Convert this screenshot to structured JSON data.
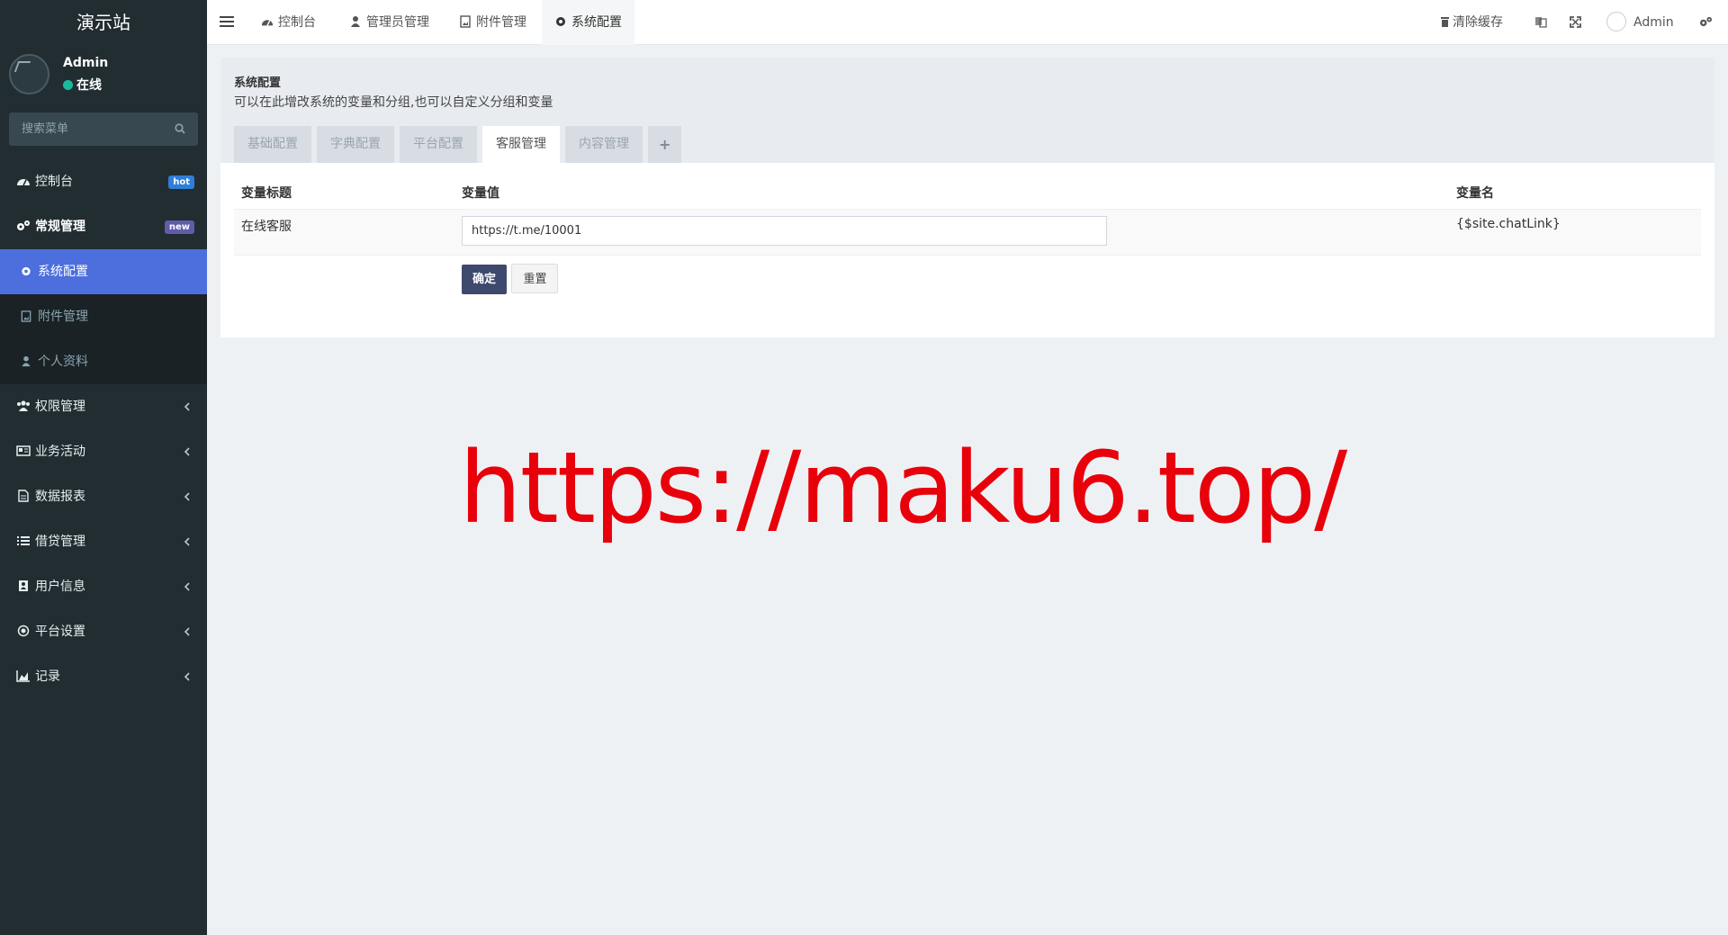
{
  "app": {
    "title": "演示站"
  },
  "user": {
    "name": "Admin",
    "status": "在线"
  },
  "search": {
    "placeholder": "搜索菜单"
  },
  "sidebar": {
    "items": [
      {
        "label": "控制台",
        "icon": "dashboard-icon",
        "badge": "hot"
      },
      {
        "label": "常规管理",
        "icon": "cogs-icon",
        "badge": "new"
      }
    ],
    "subitems": [
      {
        "label": "系统配置",
        "icon": "gear-icon"
      },
      {
        "label": "附件管理",
        "icon": "file-image-icon"
      },
      {
        "label": "个人资料",
        "icon": "user-icon"
      }
    ],
    "groups": [
      {
        "label": "权限管理",
        "icon": "group-icon"
      },
      {
        "label": "业务活动",
        "icon": "newspaper-icon"
      },
      {
        "label": "数据报表",
        "icon": "file-text-icon"
      },
      {
        "label": "借贷管理",
        "icon": "list-icon"
      },
      {
        "label": "用户信息",
        "icon": "address-book-icon"
      },
      {
        "label": "平台设置",
        "icon": "circle-dot-icon"
      },
      {
        "label": "记录",
        "icon": "area-chart-icon"
      }
    ]
  },
  "topbar": {
    "tabs": [
      {
        "label": "控制台",
        "icon": "dashboard-icon"
      },
      {
        "label": "管理员管理",
        "icon": "user-icon"
      },
      {
        "label": "附件管理",
        "icon": "file-image-icon"
      },
      {
        "label": "系统配置",
        "icon": "gear-icon"
      }
    ],
    "clear_cache": "清除缓存",
    "admin": "Admin"
  },
  "panel": {
    "title": "系统配置",
    "description": "可以在此增改系统的变量和分组,也可以自定义分组和变量",
    "tabs": [
      "基础配置",
      "字典配置",
      "平台配置",
      "客服管理",
      "内容管理"
    ],
    "active_tab": "客服管理",
    "add_tab": "+"
  },
  "table": {
    "headers": [
      "变量标题",
      "变量值",
      "变量名"
    ],
    "rows": [
      {
        "title": "在线客服",
        "value": "https://t.me/10001",
        "name": "{$site.chatLink}"
      }
    ]
  },
  "buttons": {
    "submit": "确定",
    "reset": "重置"
  },
  "watermark": "https://maku6.top/",
  "colors": {
    "sidebar_bg": "#222d32",
    "active_menu": "#4c6fdd",
    "primary_button": "#3d4a6e",
    "watermark": "#e8000b"
  }
}
